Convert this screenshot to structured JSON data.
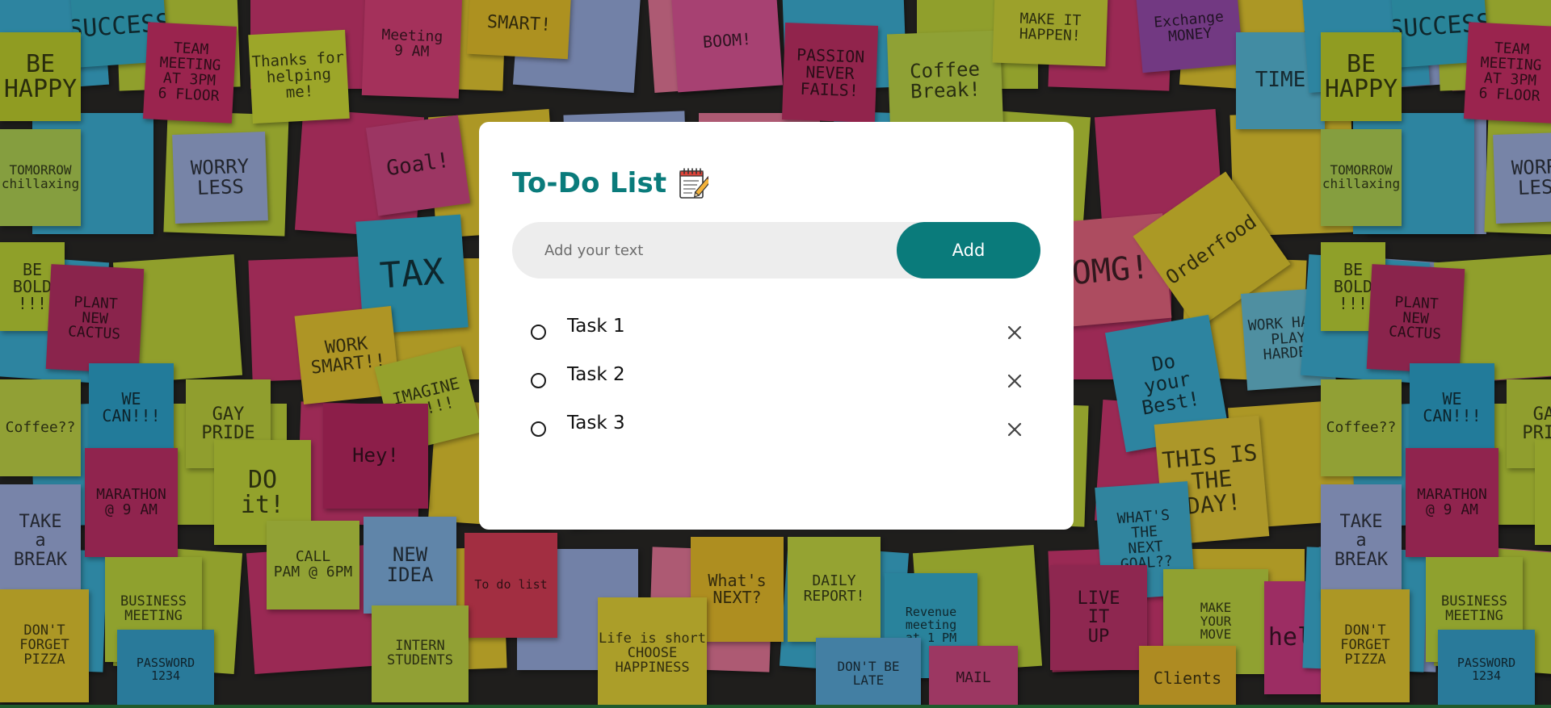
{
  "app": {
    "title": "To-Do List",
    "title_icon": "notepad-icon"
  },
  "input": {
    "placeholder": "Add your text",
    "value": ""
  },
  "add_button": {
    "label": "Add"
  },
  "tasks": [
    {
      "text": "Task 1",
      "checked": false,
      "delete_icon": "close-icon"
    },
    {
      "text": "Task 2",
      "checked": false,
      "delete_icon": "close-icon"
    },
    {
      "text": "Task 3",
      "checked": false,
      "delete_icon": "close-icon"
    }
  ],
  "colors": {
    "accent": "#0a7b7b",
    "input_bg": "#ededed",
    "card_bg": "#ffffff"
  },
  "background": {
    "description_icon": "sticky-notes-background",
    "notes": [
      {
        "text": "SUCCESS",
        "color": "#39b8d4"
      },
      {
        "text": "BE\nHAPPY",
        "color": "#c8d930"
      },
      {
        "text": "TEAM MEETING\nAT 3PM\n6 FLOOR",
        "color": "#d6336c"
      },
      {
        "text": "Thanks for\nhelping me!",
        "color": "#d9e63a"
      },
      {
        "text": "Meeting\n9 AM",
        "color": "#e4457e"
      },
      {
        "text": "SMART!",
        "color": "#f0c92d"
      },
      {
        "text": "BOOM!",
        "color": "#e85a9e"
      },
      {
        "text": "PASSION\nNEVER\nFAILS!",
        "color": "#c9336a"
      },
      {
        "text": "Coffee\nBreak!",
        "color": "#c7e04a"
      },
      {
        "text": "MAKE IT\nHAPPEN!",
        "color": "#d8e03c"
      },
      {
        "text": "Exchange\nMONEY",
        "color": "#9e4fb5"
      },
      {
        "text": "TIME",
        "color": "#5cc2e2"
      },
      {
        "text": "TOMORROW\nchillaxing",
        "color": "#b9dc58"
      },
      {
        "text": "WORRY\nLESS",
        "color": "#a5b7e8"
      },
      {
        "text": "Goal!",
        "color": "#d94b8a"
      },
      {
        "text": "TAX",
        "color": "#36b6d9"
      },
      {
        "text": "OMG!",
        "color": "#f06a86"
      },
      {
        "text": "Orderfood",
        "color": "#eed534"
      },
      {
        "text": "WORK HARD\nPLAY\nHARDER",
        "color": "#6ec7e0"
      },
      {
        "text": "BE\nBOLD\n!!!",
        "color": "#c7de3a"
      },
      {
        "text": "PLANT\nNEW\nCACTUS",
        "color": "#c0336a"
      },
      {
        "text": "WORK\nSMART!!",
        "color": "#f1cf34"
      },
      {
        "text": "IMAGINE\n!!!!!",
        "color": "#cfe03d"
      },
      {
        "text": "Do\nyour\nBest!",
        "color": "#3fb8de"
      },
      {
        "text": "Coffee??",
        "color": "#c9de4a"
      },
      {
        "text": "WE\nCAN!!!",
        "color": "#30abd6"
      },
      {
        "text": "GAY\nPRIDE",
        "color": "#c8dc40"
      },
      {
        "text": "Hey!",
        "color": "#c22a66"
      },
      {
        "text": "THIS IS\nTHE\nDAY!",
        "color": "#efd23a"
      },
      {
        "text": "MARATHON\n@ 9 AM",
        "color": "#c8336d"
      },
      {
        "text": "DO\nit!",
        "color": "#cce13e"
      },
      {
        "text": "WHAT'S\nTHE\nNEXT GOAL??",
        "color": "#43b7dc"
      },
      {
        "text": "TAKE\na\nBREAK",
        "color": "#a7b8ea"
      },
      {
        "text": "CALL\nPAM @ 6PM",
        "color": "#c9df48"
      },
      {
        "text": "NEW\nIDEA",
        "color": "#86b9ea"
      },
      {
        "text": "To do list",
        "color": "#e1405a"
      },
      {
        "text": "What's\nNEXT?",
        "color": "#f2c52d"
      },
      {
        "text": "DAILY\nREPORT!",
        "color": "#cfe246"
      },
      {
        "text": "Revenue meeting\nat 1 PM",
        "color": "#3ab6d8"
      },
      {
        "text": "LIVE\nIT\nUP",
        "color": "#c53670"
      },
      {
        "text": "MAKE\nYOUR\nMOVE",
        "color": "#c8df45"
      },
      {
        "text": "hello",
        "color": "#d93f8a"
      },
      {
        "text": "BUSINESS\nMEETING",
        "color": "#c6df40"
      },
      {
        "text": "DON'T\nFORGET\nPIZZA",
        "color": "#efd234"
      },
      {
        "text": "PASSWORD\n1234",
        "color": "#3aa9d6"
      },
      {
        "text": "INTERN\nSTUDENTS",
        "color": "#c9de48"
      },
      {
        "text": "Life is short\nCHOOSE\nHAPPINESS",
        "color": "#eedb3a"
      },
      {
        "text": "DON'T BE\nLATE",
        "color": "#5db1e2"
      },
      {
        "text": "MAIL",
        "color": "#d84d88"
      },
      {
        "text": "Clients",
        "color": "#f1c130"
      }
    ]
  }
}
